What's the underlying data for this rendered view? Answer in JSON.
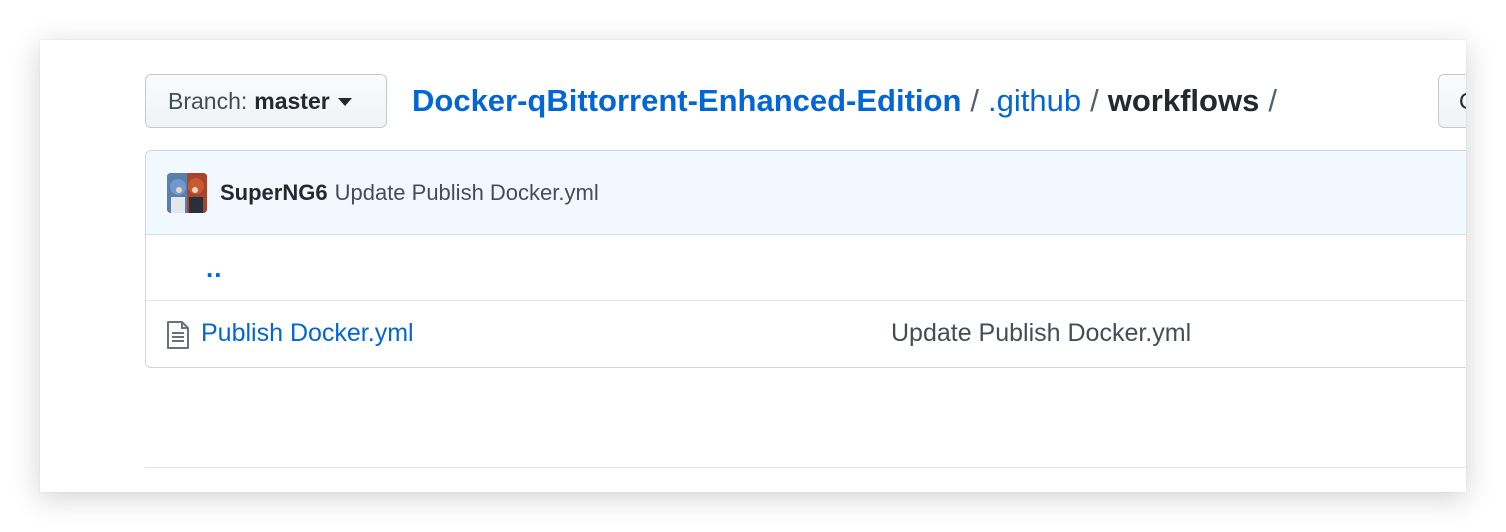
{
  "branch": {
    "prefix": "Branch:",
    "name": "master"
  },
  "breadcrumb": {
    "root": "Docker-qBittorrent-Enhanced-Edition",
    "sep1": "/",
    "dir": ".github",
    "sep2": "/",
    "current": "workflows",
    "sep3": "/"
  },
  "right_button": {
    "label": "C"
  },
  "commit": {
    "author": "SuperNG6",
    "message": "Update Publish Docker.yml"
  },
  "files": {
    "parent_link": "..",
    "rows": [
      {
        "name": "Publish Docker.yml",
        "commit_message": "Update Publish Docker.yml",
        "icon": "file-icon"
      }
    ]
  },
  "colors": {
    "link": "#0366d6",
    "commit_bar_bg": "#f1f8ff",
    "text": "#24292e"
  }
}
